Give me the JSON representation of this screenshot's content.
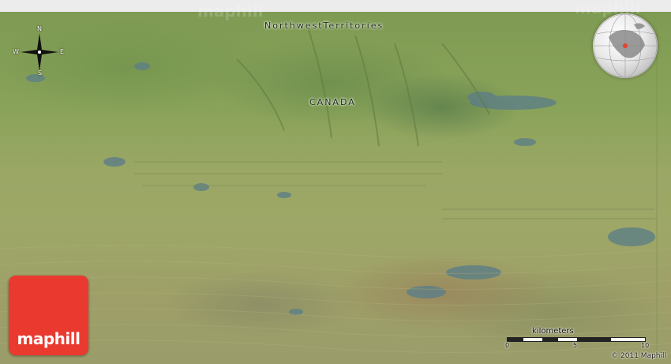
{
  "map": {
    "labels": {
      "region": "NorthwestTerritories",
      "country": "CANADA"
    },
    "compass": {
      "n": "N",
      "s": "S",
      "e": "E",
      "w": "W"
    },
    "logo_text": "maphill",
    "watermark": "maphill",
    "scale": {
      "unit": "kilometers",
      "ticks": [
        "0",
        "5",
        "10"
      ]
    },
    "copyright": "© 2011 Maphill",
    "colors": {
      "logo": "#ea3a30"
    },
    "icons": [
      "compass-icon",
      "globe-locator-icon"
    ]
  }
}
